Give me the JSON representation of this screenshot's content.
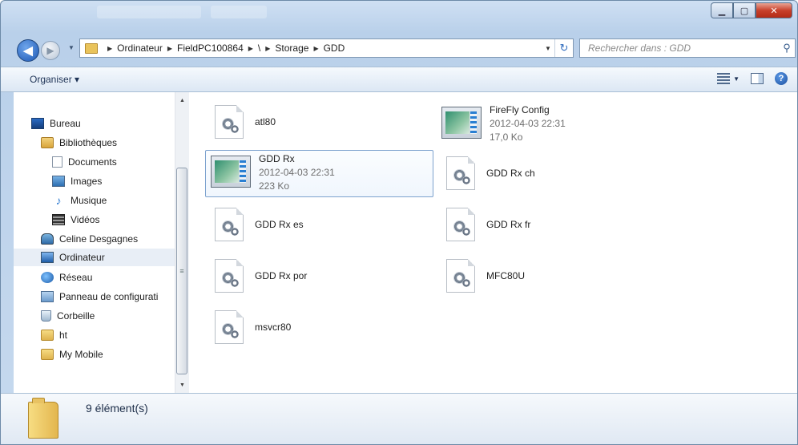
{
  "window": {
    "buttons": {
      "minimize": "▁",
      "maximize": "▢",
      "close": "✕"
    }
  },
  "nav": {
    "back_icon": "back-arrow-icon",
    "forward_icon": "forward-arrow-icon",
    "breadcrumb": [
      "Ordinateur",
      "FieldPC100864",
      "\\",
      "Storage",
      "GDD"
    ],
    "search_placeholder": "Rechercher dans : GDD"
  },
  "toolbar": {
    "organise_label": "Organiser ▾"
  },
  "sidebar": {
    "items": [
      {
        "label": "Bureau",
        "icon": "desktop-icon"
      },
      {
        "label": "Bibliothèques",
        "icon": "library-icon"
      },
      {
        "label": "Documents",
        "icon": "documents-icon"
      },
      {
        "label": "Images",
        "icon": "images-icon"
      },
      {
        "label": "Musique",
        "icon": "music-icon"
      },
      {
        "label": "Vidéos",
        "icon": "videos-icon"
      },
      {
        "label": "Celine Desgagnes",
        "icon": "user-folder-icon"
      },
      {
        "label": "Ordinateur",
        "icon": "computer-icon",
        "selected": true
      },
      {
        "label": "Réseau",
        "icon": "network-icon"
      },
      {
        "label": "Panneau de configurati",
        "icon": "control-panel-icon"
      },
      {
        "label": "Corbeille",
        "icon": "recycle-bin-icon"
      },
      {
        "label": "ht",
        "icon": "folder-icon"
      },
      {
        "label": "My Mobile",
        "icon": "folder-icon"
      }
    ]
  },
  "files": [
    {
      "name": "atl80",
      "icon": "dll-gear-icon"
    },
    {
      "name": "FireFly Config",
      "date": "2012-04-03 22:31",
      "size": "17,0 Ko",
      "icon": "application-icon"
    },
    {
      "name": "GDD Rx",
      "date": "2012-04-03 22:31",
      "size": "223 Ko",
      "icon": "application-icon",
      "selected": true
    },
    {
      "name": "GDD Rx ch",
      "icon": "dll-gear-icon"
    },
    {
      "name": "GDD Rx es",
      "icon": "dll-gear-icon"
    },
    {
      "name": "GDD Rx fr",
      "icon": "dll-gear-icon"
    },
    {
      "name": "GDD Rx por",
      "icon": "dll-gear-icon"
    },
    {
      "name": "MFC80U",
      "icon": "dll-gear-icon"
    },
    {
      "name": "msvcr80",
      "icon": "dll-gear-icon"
    }
  ],
  "status": {
    "count": "9 élément(s)"
  }
}
